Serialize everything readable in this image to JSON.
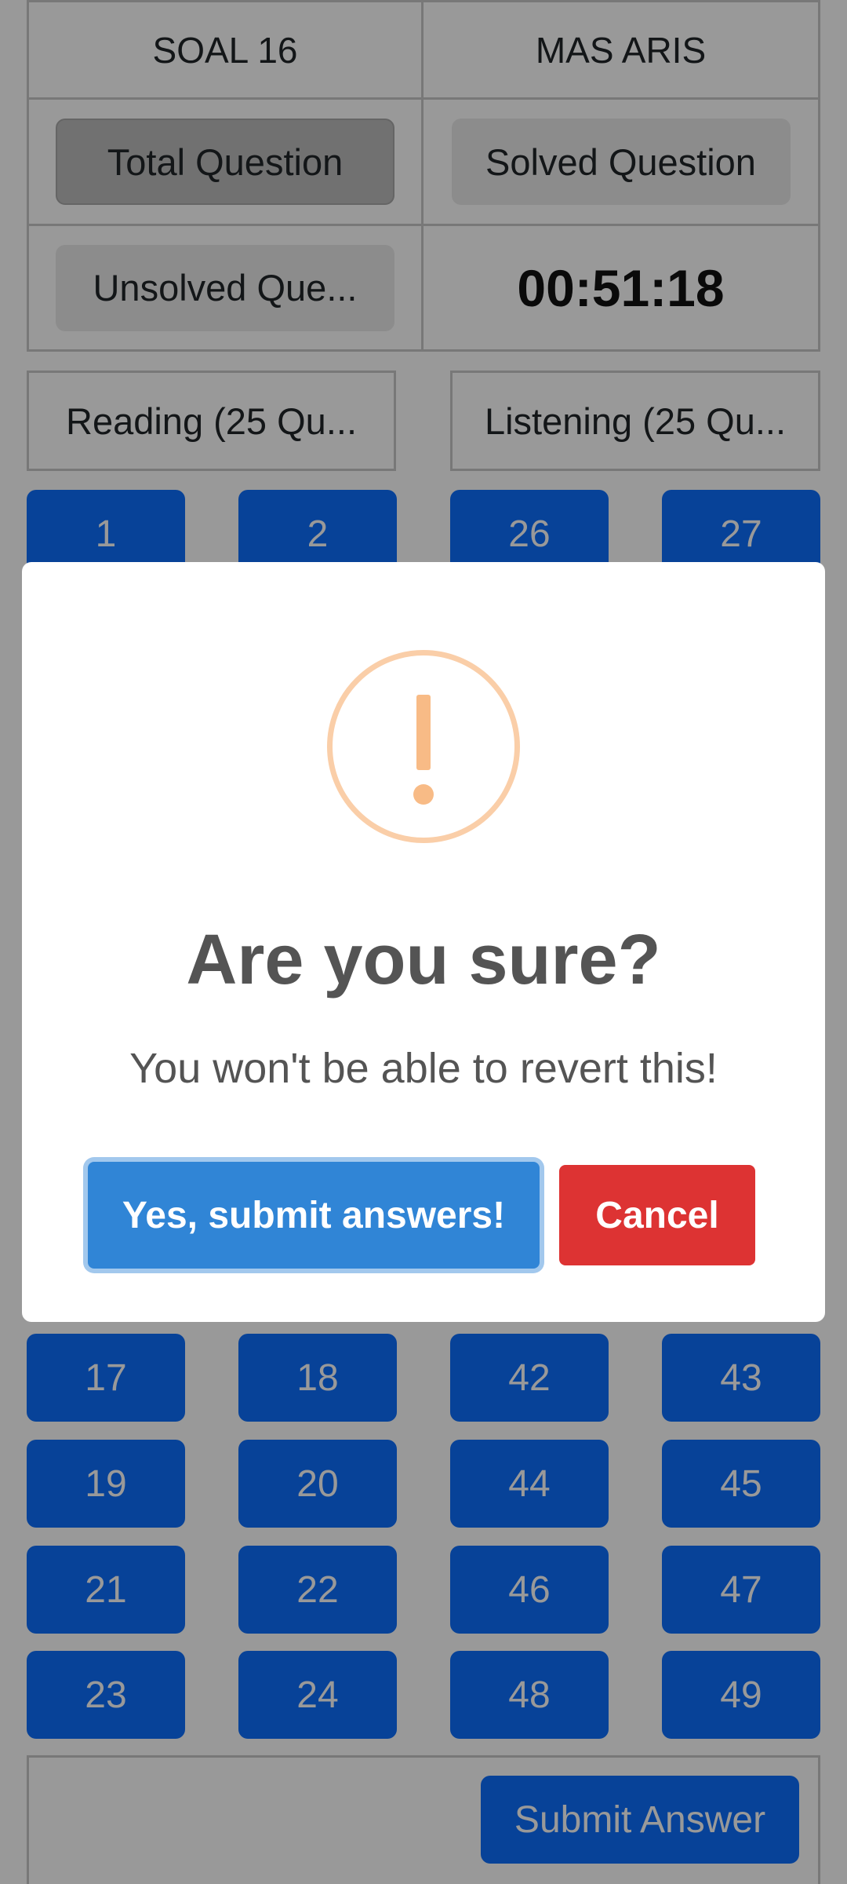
{
  "info": {
    "exam_name": "SOAL 16",
    "user_name": "MAS ARIS",
    "total_question_label": "Total Question",
    "solved_question_label": "Solved Question",
    "unsolved_question_label": "Unsolved Que...",
    "timer": "00:51:18"
  },
  "sections": {
    "reading_label": "Reading (25 Qu...",
    "listening_label": "Listening (25 Qu..."
  },
  "questions": {
    "top_row": [
      "1",
      "2",
      "26",
      "27"
    ],
    "bottom_rows": [
      [
        "17",
        "18",
        "42",
        "43"
      ],
      [
        "19",
        "20",
        "44",
        "45"
      ],
      [
        "21",
        "22",
        "46",
        "47"
      ],
      [
        "23",
        "24",
        "48",
        "49"
      ]
    ]
  },
  "footer": {
    "submit_label": "Submit Answer"
  },
  "modal": {
    "title": "Are you sure?",
    "text": "You won't be able to revert this!",
    "confirm_label": "Yes, submit answers!",
    "cancel_label": "Cancel"
  },
  "colors": {
    "primary": "#0d6efd",
    "confirm": "#3085d6",
    "cancel": "#dd3333",
    "warning": "#f8bb86"
  }
}
